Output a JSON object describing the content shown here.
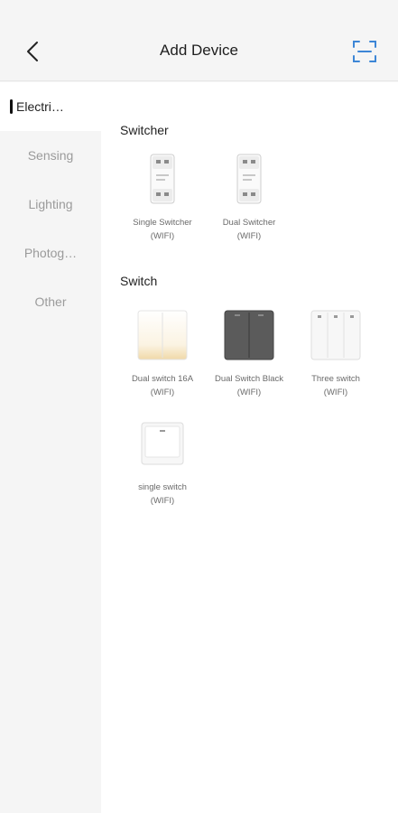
{
  "header": {
    "title": "Add Device",
    "back_icon": "chevron-left-icon",
    "scan_icon": "scan-icon",
    "accent": "#3d86d6"
  },
  "sidebar": {
    "items": [
      {
        "label": "Electri…",
        "active": true
      },
      {
        "label": "Sensing"
      },
      {
        "label": "Lighting"
      },
      {
        "label": "Photog…"
      },
      {
        "label": "Other"
      }
    ]
  },
  "sections": [
    {
      "title": "Switcher",
      "devices": [
        {
          "name": "Single Switcher",
          "protocol": "(WIFI)",
          "icon": "relay-module-icon"
        },
        {
          "name": "Dual Switcher",
          "protocol": "(WIFI)",
          "icon": "relay-module-icon"
        }
      ]
    },
    {
      "title": "Switch",
      "devices": [
        {
          "name": "Dual switch 16A",
          "protocol": "(WIFI)",
          "icon": "dual-white-switch-icon"
        },
        {
          "name": "Dual Switch Black",
          "protocol": "(WIFI)",
          "icon": "dual-black-switch-icon"
        },
        {
          "name": "Three switch",
          "protocol": "(WIFI)",
          "icon": "three-gang-switch-icon"
        },
        {
          "name": "single switch",
          "protocol": "(WIFI)",
          "icon": "single-switch-icon"
        }
      ]
    }
  ]
}
